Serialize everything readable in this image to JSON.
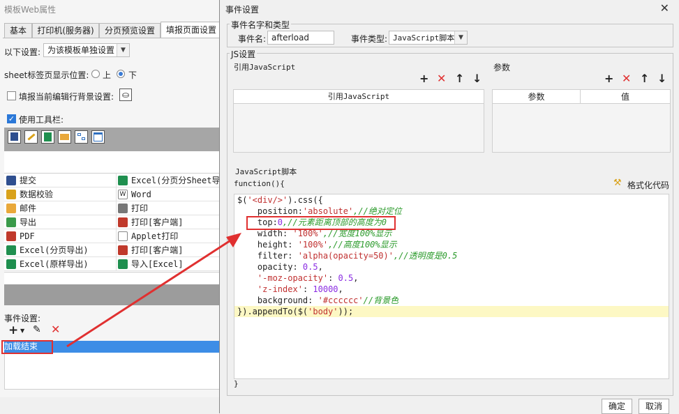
{
  "left": {
    "title": "模板Web属性",
    "tabs": [
      "基本",
      "打印机(服务器)",
      "分页预览设置",
      "填报页面设置"
    ],
    "following_label": "以下设置:",
    "following_value": "为该模板单独设置",
    "sheet_label": "sheet标签页显示位置:",
    "sheet_top": "上",
    "sheet_bottom": "下",
    "fill_bg_label": "填报当前编辑行背景设置:",
    "use_toolbar_label": "使用工具栏:",
    "grid": [
      [
        "提交",
        "Excel(分页分Sheet导出)"
      ],
      [
        "数据校验",
        "Word"
      ],
      [
        "邮件",
        "打印"
      ],
      [
        "导出",
        "打印[客户端]"
      ],
      [
        "PDF",
        "Applet打印"
      ],
      [
        "Excel(分页导出)",
        "打印[客户端]"
      ],
      [
        "Excel(原样导出)",
        "导入[Excel]"
      ]
    ],
    "event_settings_label": "事件设置:",
    "event_item": "加载结束"
  },
  "dialog": {
    "title": "事件设置",
    "name_group": "事件名字和类型",
    "event_name_label": "事件名:",
    "event_name_value": "afterload",
    "event_type_label": "事件类型:",
    "event_type_value": "JavaScript脚本",
    "js_group": "JS设置",
    "ref_js_label": "引用JavaScript",
    "params_label": "参数",
    "ref_js_col": "引用JavaScript",
    "param_col": "参数",
    "value_col": "值",
    "script_label": "JavaScript脚本",
    "func_open": "function(){",
    "format_label": "格式化代码",
    "func_close": "}",
    "ok": "确定",
    "cancel": "取消",
    "code": {
      "l1a": "$(",
      "l1b": "'<div/>'",
      "l1c": ").css({",
      "l2a": "    position:",
      "l2b": "'absolute'",
      "l2c": ",//绝对定位",
      "l3a": "    top:",
      "l3b": "0",
      "l3c": ",//元素距离顶部的高度为0",
      "l4a": "    width: ",
      "l4b": "'100%'",
      "l4c": ",//宽度100%显示",
      "l5a": "    height: ",
      "l5b": "'100%'",
      "l5c": ",//高度100%显示",
      "l6a": "    filter: ",
      "l6b": "'alpha(opacity=50)'",
      "l6c": ",//透明度是0.5",
      "l7a": "    opacity: ",
      "l7b": "0.5",
      "l7c": ",",
      "l8a": "    ",
      "l8b": "'-moz-opacity'",
      "l8c": ": ",
      "l8d": "0.5",
      "l8e": ",",
      "l9a": "    ",
      "l9b": "'z-index'",
      "l9c": ": ",
      "l9d": "10000",
      "l9e": ",",
      "l10a": "    background: ",
      "l10b": "'#cccccc'",
      "l10c": "//背景色",
      "l11a": "}).appendTo($(",
      "l11b": "'body'",
      "l11c": "));"
    }
  },
  "colors": {
    "highlight_red": "#e03030",
    "selection_blue": "#3d8de6",
    "comment_green": "#2a9a2a",
    "string_red": "#c03030",
    "number_purple": "#8a2be2"
  }
}
